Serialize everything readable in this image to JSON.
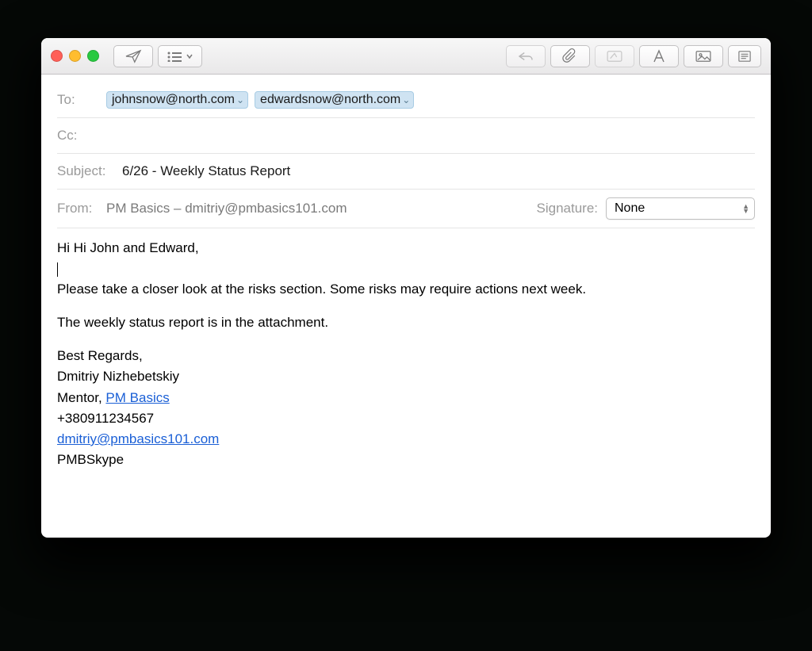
{
  "recipients": {
    "to_label": "To:",
    "to": [
      "johnsnow@north.com",
      "edwardsnow@north.com"
    ],
    "cc_label": "Cc:"
  },
  "subject_label": "Subject:",
  "subject": "6/26 - Weekly Status Report",
  "from_label": "From:",
  "from": "PM Basics – dmitriy@pmbasics101.com",
  "signature_label": "Signature:",
  "signature_selected": "None",
  "body": {
    "greeting": "Hi Hi John and Edward,",
    "para1": "Please take a closer look at the risks section. Some risks may require actions next week.",
    "para2": "The weekly status report is in the attachment.",
    "closing": "Best Regards,",
    "name": "Dmitriy Nizhebetskiy",
    "role_prefix": "Mentor, ",
    "role_link": "PM Basics",
    "phone": "+380911234567",
    "email": "dmitriy@pmbasics101.com",
    "skype": "PMBSkype"
  }
}
